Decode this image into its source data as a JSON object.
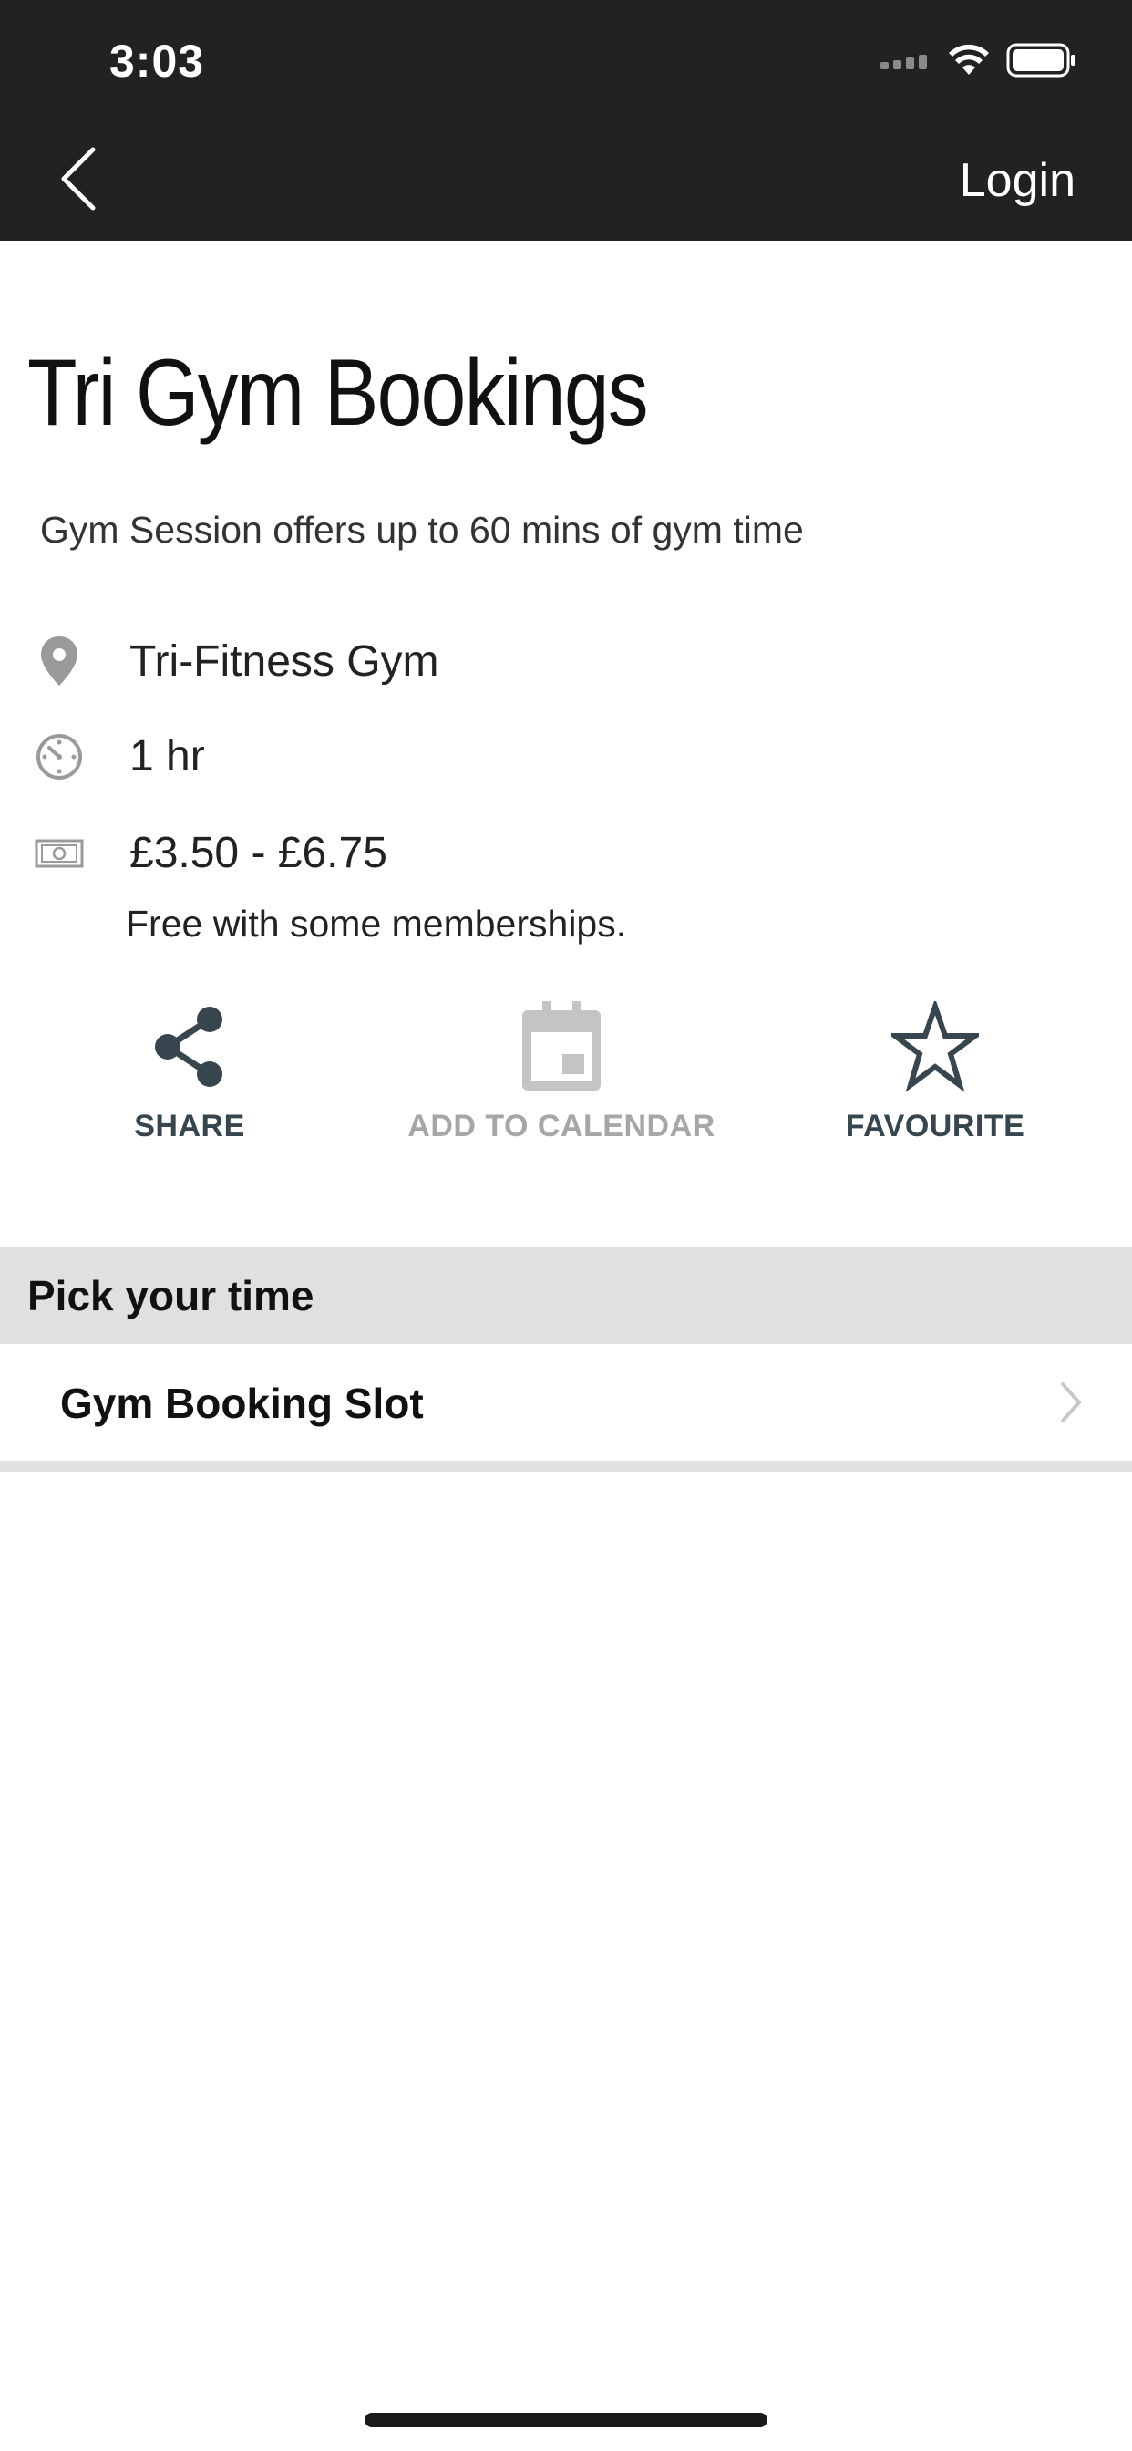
{
  "status_bar": {
    "time": "3:03"
  },
  "header": {
    "back_icon": "chevron-left-icon",
    "login_label": "Login"
  },
  "event": {
    "title": "Tri Gym Bookings",
    "description": "Gym Session offers up to 60 mins of gym time",
    "location": "Tri-Fitness Gym",
    "duration": "1 hr",
    "price": "£3.50 - £6.75",
    "price_note": "Free with some memberships."
  },
  "actions": {
    "share_label": "SHARE",
    "calendar_label": "ADD TO CALENDAR",
    "favourite_label": "FAVOURITE"
  },
  "pick_section": {
    "heading": "Pick your time",
    "slots": [
      {
        "label": "Gym Booking Slot"
      }
    ]
  },
  "colors": {
    "header_bg": "#222222",
    "action_icon": "#37454f",
    "disabled": "#a6a6a6",
    "section_bg": "#e0e0e0"
  }
}
